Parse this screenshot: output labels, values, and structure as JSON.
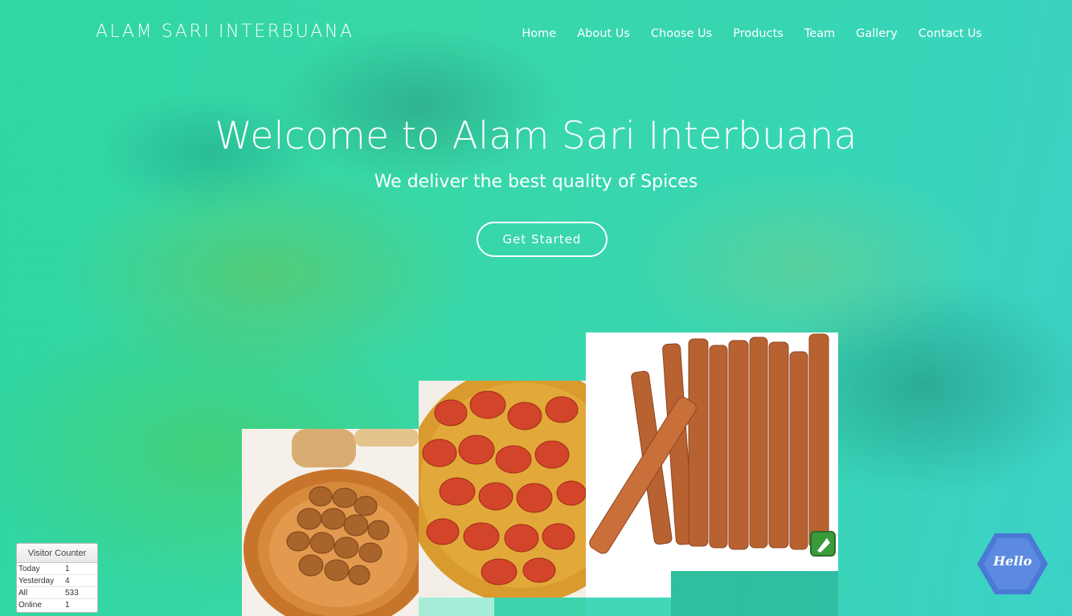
{
  "header": {
    "brand": "ALAM SARI INTERBUANA",
    "nav": [
      "Home",
      "About Us",
      "Choose Us",
      "Products",
      "Team",
      "Gallery",
      "Contact Us"
    ]
  },
  "hero": {
    "title": "Welcome to Alam Sari Interbuana",
    "subtitle": "We deliver the best quality of Spices",
    "cta": "Get Started"
  },
  "visitor_counter": {
    "title": "Visitor Counter",
    "rows": [
      {
        "label": "Today",
        "value": "1"
      },
      {
        "label": "Yesterday",
        "value": "4"
      },
      {
        "label": "All",
        "value": "533"
      },
      {
        "label": "Online",
        "value": "1"
      }
    ]
  },
  "chat": {
    "label": "Hello"
  },
  "colors": {
    "hero_teal": "#38d6b0",
    "chat_blue": "#4a79d6"
  }
}
